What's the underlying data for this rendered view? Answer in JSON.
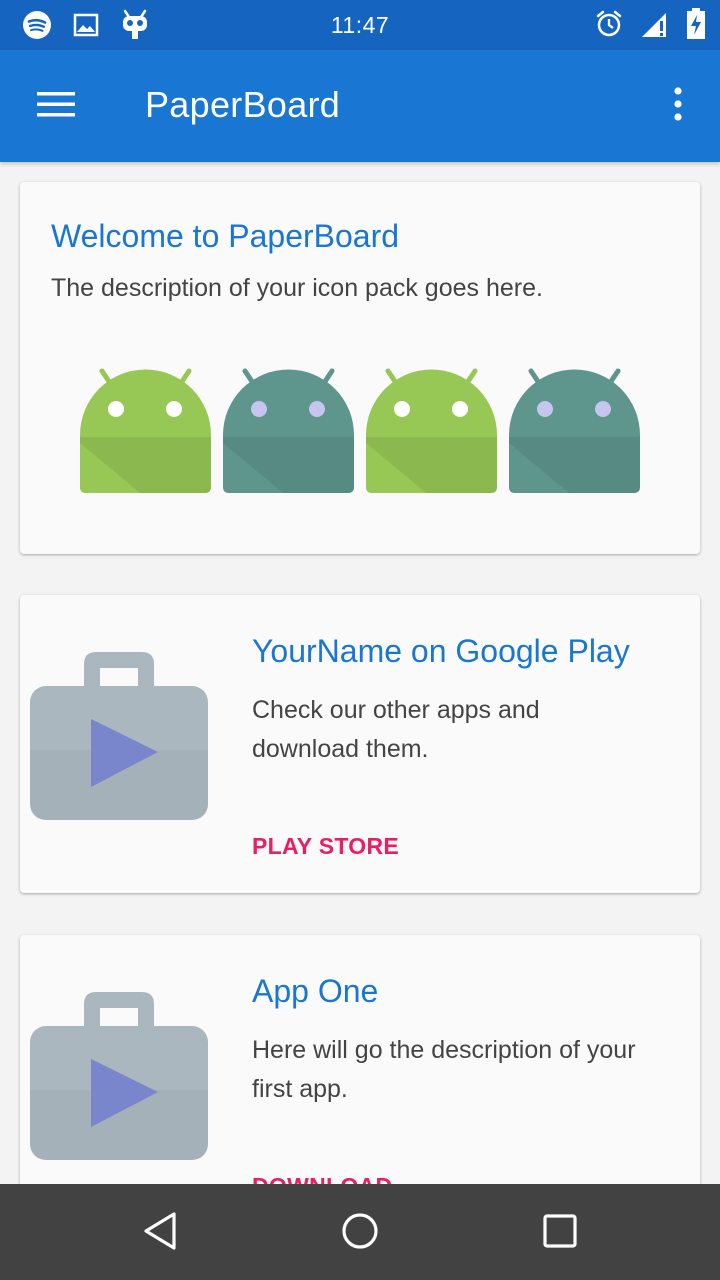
{
  "status_bar": {
    "time": "11:47",
    "left_icons": [
      "spotify-icon",
      "image-icon",
      "cyanogen-icon"
    ],
    "right_icons": [
      "alarm-icon",
      "signal-icon",
      "battery-charging-icon"
    ]
  },
  "app_bar": {
    "title": "PaperBoard",
    "menu_icon": "hamburger-menu-icon",
    "overflow_icon": "more-vertical-icon"
  },
  "cards": [
    {
      "title": "Welcome to PaperBoard",
      "description": "The description of your icon pack goes here.",
      "images": [
        "android-robot-green",
        "android-robot-teal",
        "android-robot-green",
        "android-robot-teal"
      ]
    },
    {
      "title": "YourName on Google Play",
      "description": "Check our other apps and download them.",
      "action": "PLAY STORE",
      "icon": "play-store-bag-icon"
    },
    {
      "title": "App One",
      "description": "Here will go the description of your first app.",
      "action": "DOWNLOAD",
      "icon": "play-store-bag-icon"
    }
  ],
  "nav_bar": {
    "buttons": [
      "back-icon",
      "home-icon",
      "recents-icon"
    ]
  },
  "colors": {
    "status_bar": "#1565c0",
    "app_bar": "#1976d2",
    "title_text": "#1976d2",
    "action_text": "#e91e63",
    "robot_green": "#97c855",
    "robot_teal": "#5e958d",
    "nav_bar": "#424242"
  }
}
